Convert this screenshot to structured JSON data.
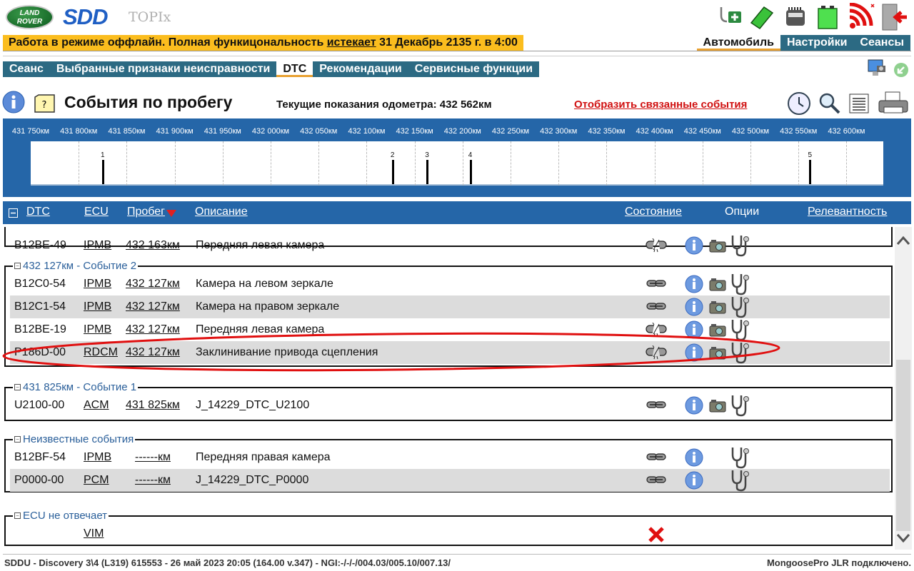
{
  "app": {
    "logo_text": "LAND ROVER",
    "product": "SDD",
    "module": "TOPIx"
  },
  "banner": {
    "text_before": "Работа в режиме оффлайн. Полная функицональность ",
    "link": "истекает",
    "text_after": " 31 Декабрь 2135 г. в 4:00"
  },
  "top_icons": [
    "stethoscope-medkit-icon",
    "green-card-icon",
    "vci-device-icon",
    "battery-icon",
    "wifi-disconnected-icon",
    "exit-door-icon"
  ],
  "top_tabs": [
    {
      "label": "Автомобиль",
      "active": true
    },
    {
      "label": "Настройки",
      "active": false
    },
    {
      "label": "Сеансы",
      "active": false
    }
  ],
  "nav_tabs": [
    {
      "label": "Сеанс",
      "active": false
    },
    {
      "label": "Выбранные признаки неисправности",
      "active": false
    },
    {
      "label": "DTC",
      "active": true
    },
    {
      "label": "Рекомендации",
      "active": false
    },
    {
      "label": "Сервисные функции",
      "active": false
    }
  ],
  "page": {
    "title": "События по пробегу",
    "odometer": "Текущие показания одометра: 432 562км",
    "related_link": "Отобразить связанные события"
  },
  "timeline": {
    "tick_labels": [
      "431 750км",
      "431 800км",
      "431 850км",
      "431 900км",
      "431 950км",
      "432 000км",
      "432 050км",
      "432 100км",
      "432 150км",
      "432 200км",
      "432 250км",
      "432 300км",
      "432 350км",
      "432 400км",
      "432 450км",
      "432 500км",
      "432 550км",
      "432 600км"
    ],
    "range_km": [
      431750,
      432637
    ],
    "events": [
      {
        "label": "1",
        "km": 431825
      },
      {
        "label": "2",
        "km": 432127
      },
      {
        "label": "3",
        "km": 432163
      },
      {
        "label": "4",
        "km": 432208
      },
      {
        "label": "5",
        "km": 432562
      }
    ]
  },
  "columns": {
    "dtc": "DTC",
    "ecu": "ECU",
    "mileage": "Пробег",
    "description": "Описание",
    "state": "Состояние",
    "options": "Опции",
    "relevance": "Релевантность"
  },
  "groups": [
    {
      "legend": "",
      "rows": [
        {
          "dtc": "B12BE-49",
          "ecu": "IPMB",
          "km": "432 163км",
          "desc": "Передняя левая камера",
          "state": "intermittent",
          "camera": true,
          "steth": true,
          "info": true
        }
      ]
    },
    {
      "legend": "432 127км - Событие 2",
      "rows": [
        {
          "dtc": "B12C0-54",
          "ecu": "IPMB",
          "km": "432 127км",
          "desc": "Камера на левом зеркале",
          "state": "ok",
          "camera": true,
          "steth": true,
          "info": true
        },
        {
          "dtc": "B12C1-54",
          "ecu": "IPMB",
          "km": "432 127км",
          "desc": "Камера на правом зеркале",
          "state": "ok",
          "camera": true,
          "steth": true,
          "info": true
        },
        {
          "dtc": "B12BE-19",
          "ecu": "IPMB",
          "km": "432 127км",
          "desc": "Передняя левая камера",
          "state": "intermittent",
          "camera": true,
          "steth": true,
          "info": true
        },
        {
          "dtc": "P186D-00",
          "ecu": "RDCM",
          "km": "432 127км",
          "desc": "Заклинивание привода сцепления",
          "state": "intermittent",
          "camera": true,
          "steth": true,
          "info": true,
          "highlighted": true
        }
      ]
    },
    {
      "legend": "431 825км - Событие 1",
      "rows": [
        {
          "dtc": "U2100-00",
          "ecu": "ACM",
          "km": "431 825км",
          "desc": "J_14229_DTC_U2100",
          "state": "ok",
          "camera": true,
          "steth": true,
          "info": true
        }
      ]
    },
    {
      "legend": "Неизвестные события",
      "rows": [
        {
          "dtc": "B12BF-54",
          "ecu": "IPMB",
          "km": "------км",
          "desc": "Передняя правая камера",
          "state": "ok",
          "camera": false,
          "steth": true,
          "info": true
        },
        {
          "dtc": "P0000-00",
          "ecu": "PCM",
          "km": "------км",
          "desc": "J_14229_DTC_P0000",
          "state": "ok",
          "camera": false,
          "steth": true,
          "info": true
        }
      ]
    },
    {
      "legend": "ECU не отвечает",
      "rows": [
        {
          "dtc": "",
          "ecu": "VIM",
          "km": "",
          "desc": "",
          "state": "error",
          "camera": false,
          "steth": false,
          "info": false
        }
      ]
    }
  ],
  "status": {
    "left": "SDDU - Discovery 3\\4 (L319) 615553 - 26 май 2023 20:05 (164.00 v.347) - NGI:-/-/-/004.03/005.10/007.13/",
    "right": "MongoosePro JLR подключено."
  },
  "colors": {
    "tab_blue": "#2c6a83",
    "timeline_blue": "#2566a8",
    "banner": "#fbbd1e",
    "highlight": "#e01010"
  }
}
